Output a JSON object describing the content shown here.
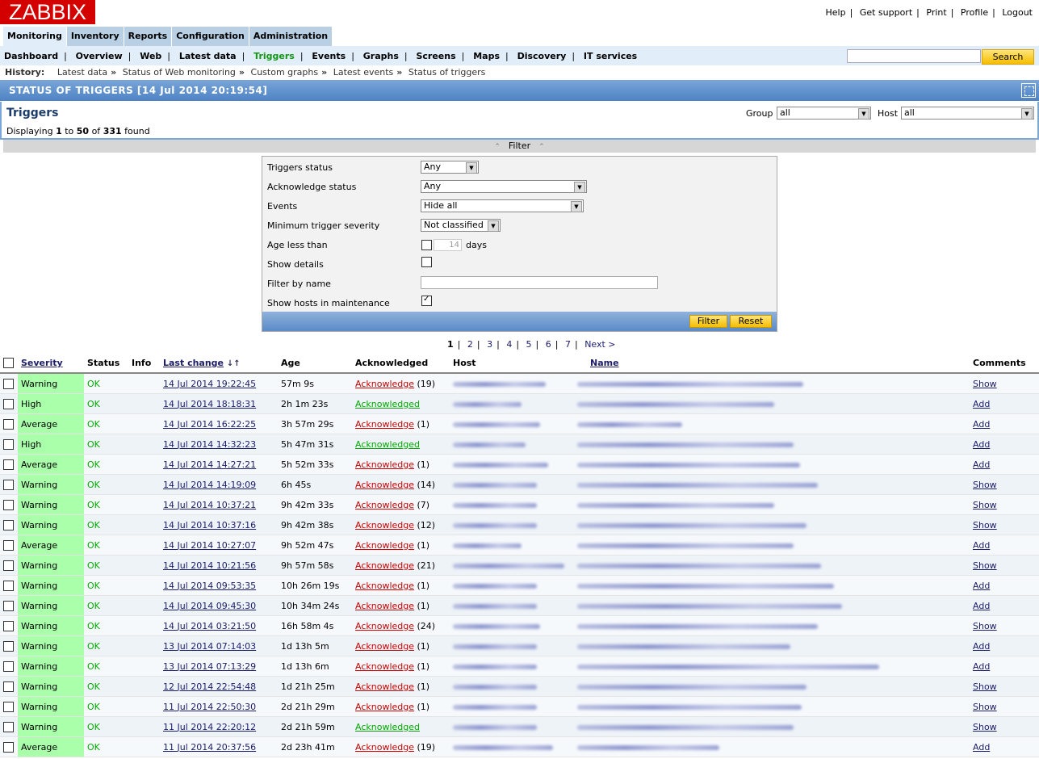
{
  "logo": "ZABBIX",
  "top_links": [
    "Help",
    "Get support",
    "Print",
    "Profile",
    "Logout"
  ],
  "main_tabs": [
    {
      "label": "Monitoring",
      "active": true
    },
    {
      "label": "Inventory",
      "active": false
    },
    {
      "label": "Reports",
      "active": false
    },
    {
      "label": "Configuration",
      "active": false
    },
    {
      "label": "Administration",
      "active": false
    }
  ],
  "sub_menu": [
    "Dashboard",
    "Overview",
    "Web",
    "Latest data",
    "Triggers",
    "Events",
    "Graphs",
    "Screens",
    "Maps",
    "Discovery",
    "IT services"
  ],
  "sub_menu_current": "Triggers",
  "search": {
    "value": "",
    "button": "Search"
  },
  "history": {
    "label": "History:",
    "items": [
      "Latest data",
      "Status of Web monitoring",
      "Custom graphs",
      "Latest events",
      "Status of triggers"
    ]
  },
  "title": "STATUS OF TRIGGERS [14 Jul 2014 20:19:54]",
  "section_title": "Triggers",
  "displaying": {
    "prefix": "Displaying",
    "from": "1",
    "to_word": "to",
    "to": "50",
    "of_word": "of",
    "total": "331",
    "suffix": "found"
  },
  "group": {
    "label": "Group",
    "value": "all"
  },
  "host": {
    "label": "Host",
    "value": "all"
  },
  "filter": {
    "bar_label": "Filter",
    "triggers_status": {
      "label": "Triggers status",
      "value": "Any"
    },
    "acknowledge_status": {
      "label": "Acknowledge status",
      "value": "Any"
    },
    "events": {
      "label": "Events",
      "value": "Hide all"
    },
    "min_severity": {
      "label": "Minimum trigger severity",
      "value": "Not classified"
    },
    "age_less_than": {
      "label": "Age less than",
      "value": "14",
      "unit": "days",
      "checked": false
    },
    "show_details": {
      "label": "Show details",
      "checked": false
    },
    "filter_by_name": {
      "label": "Filter by name",
      "value": ""
    },
    "show_hosts_maintenance": {
      "label": "Show hosts in maintenance",
      "checked": true
    },
    "filter_button": "Filter",
    "reset_button": "Reset"
  },
  "pager": {
    "current": "1",
    "pages": [
      "2",
      "3",
      "4",
      "5",
      "6",
      "7"
    ],
    "next": "Next >"
  },
  "columns": [
    "Severity",
    "Status",
    "Info",
    "Last change",
    "Age",
    "Acknowledged",
    "Host",
    "Name",
    "Comments"
  ],
  "rows": [
    {
      "severity": "Warning",
      "status": "OK",
      "last_change": "14 Jul 2014 19:22:45",
      "age": "57m 9s",
      "ack": "Acknowledge",
      "ack_count": "(19)",
      "acked": false,
      "comments": "Show"
    },
    {
      "severity": "High",
      "status": "OK",
      "last_change": "14 Jul 2014 18:18:31",
      "age": "2h 1m 23s",
      "ack": "Acknowledged",
      "ack_count": "",
      "acked": true,
      "comments": "Add"
    },
    {
      "severity": "Average",
      "status": "OK",
      "last_change": "14 Jul 2014 16:22:25",
      "age": "3h 57m 29s",
      "ack": "Acknowledge",
      "ack_count": "(1)",
      "acked": false,
      "comments": "Add"
    },
    {
      "severity": "High",
      "status": "OK",
      "last_change": "14 Jul 2014 14:32:23",
      "age": "5h 47m 31s",
      "ack": "Acknowledged",
      "ack_count": "",
      "acked": true,
      "comments": "Add"
    },
    {
      "severity": "Average",
      "status": "OK",
      "last_change": "14 Jul 2014 14:27:21",
      "age": "5h 52m 33s",
      "ack": "Acknowledge",
      "ack_count": "(1)",
      "acked": false,
      "comments": "Add"
    },
    {
      "severity": "Warning",
      "status": "OK",
      "last_change": "14 Jul 2014 14:19:09",
      "age": "6h 45s",
      "ack": "Acknowledge",
      "ack_count": "(14)",
      "acked": false,
      "comments": "Show"
    },
    {
      "severity": "Warning",
      "status": "OK",
      "last_change": "14 Jul 2014 10:37:21",
      "age": "9h 42m 33s",
      "ack": "Acknowledge",
      "ack_count": "(7)",
      "acked": false,
      "comments": "Show"
    },
    {
      "severity": "Warning",
      "status": "OK",
      "last_change": "14 Jul 2014 10:37:16",
      "age": "9h 42m 38s",
      "ack": "Acknowledge",
      "ack_count": "(12)",
      "acked": false,
      "comments": "Show"
    },
    {
      "severity": "Average",
      "status": "OK",
      "last_change": "14 Jul 2014 10:27:07",
      "age": "9h 52m 47s",
      "ack": "Acknowledge",
      "ack_count": "(1)",
      "acked": false,
      "comments": "Add"
    },
    {
      "severity": "Warning",
      "status": "OK",
      "last_change": "14 Jul 2014 10:21:56",
      "age": "9h 57m 58s",
      "ack": "Acknowledge",
      "ack_count": "(21)",
      "acked": false,
      "comments": "Show"
    },
    {
      "severity": "Warning",
      "status": "OK",
      "last_change": "14 Jul 2014 09:53:35",
      "age": "10h 26m 19s",
      "ack": "Acknowledge",
      "ack_count": "(1)",
      "acked": false,
      "comments": "Add"
    },
    {
      "severity": "Warning",
      "status": "OK",
      "last_change": "14 Jul 2014 09:45:30",
      "age": "10h 34m 24s",
      "ack": "Acknowledge",
      "ack_count": "(1)",
      "acked": false,
      "comments": "Add"
    },
    {
      "severity": "Warning",
      "status": "OK",
      "last_change": "14 Jul 2014 03:21:50",
      "age": "16h 58m 4s",
      "ack": "Acknowledge",
      "ack_count": "(24)",
      "acked": false,
      "comments": "Show"
    },
    {
      "severity": "Warning",
      "status": "OK",
      "last_change": "13 Jul 2014 07:14:03",
      "age": "1d 13h 5m",
      "ack": "Acknowledge",
      "ack_count": "(1)",
      "acked": false,
      "comments": "Add"
    },
    {
      "severity": "Warning",
      "status": "OK",
      "last_change": "13 Jul 2014 07:13:29",
      "age": "1d 13h 6m",
      "ack": "Acknowledge",
      "ack_count": "(1)",
      "acked": false,
      "comments": "Add"
    },
    {
      "severity": "Warning",
      "status": "OK",
      "last_change": "12 Jul 2014 22:54:48",
      "age": "1d 21h 25m",
      "ack": "Acknowledge",
      "ack_count": "(1)",
      "acked": false,
      "comments": "Show"
    },
    {
      "severity": "Warning",
      "status": "OK",
      "last_change": "11 Jul 2014 22:50:30",
      "age": "2d 21h 29m",
      "ack": "Acknowledge",
      "ack_count": "(1)",
      "acked": false,
      "comments": "Show"
    },
    {
      "severity": "Warning",
      "status": "OK",
      "last_change": "11 Jul 2014 22:20:12",
      "age": "2d 21h 59m",
      "ack": "Acknowledged",
      "ack_count": "",
      "acked": true,
      "comments": "Show"
    },
    {
      "severity": "Average",
      "status": "OK",
      "last_change": "11 Jul 2014 20:37:56",
      "age": "2d 23h 41m",
      "ack": "Acknowledge",
      "ack_count": "(19)",
      "acked": false,
      "comments": "Add"
    }
  ],
  "colors": {
    "logo_red": "#d40000",
    "ok_green": "#00aa00",
    "severity_bg": "#aaffaa",
    "ack_red": "#cc0000"
  }
}
